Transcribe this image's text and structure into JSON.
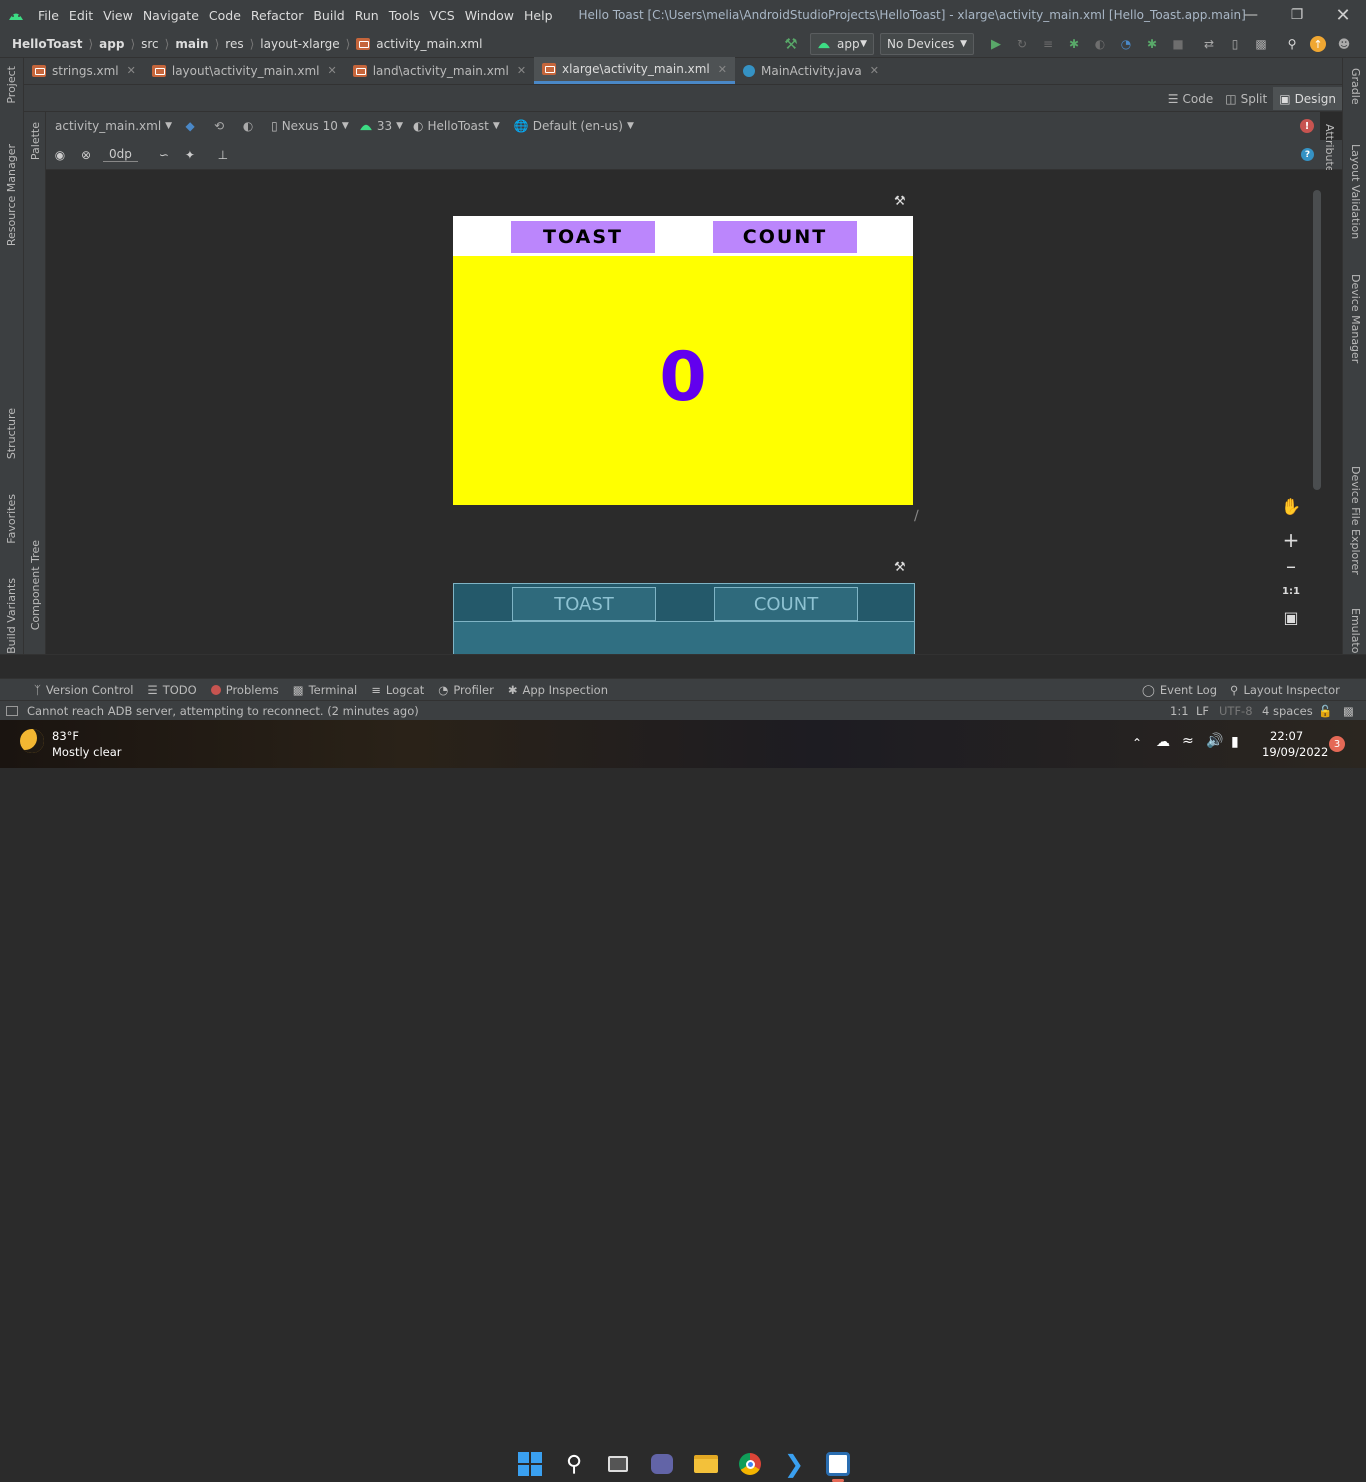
{
  "title_bar": {
    "menu": [
      "File",
      "Edit",
      "View",
      "Navigate",
      "Code",
      "Refactor",
      "Build",
      "Run",
      "Tools",
      "VCS",
      "Window",
      "Help"
    ],
    "title": "Hello Toast [C:\\Users\\melia\\AndroidStudioProjects\\HelloToast] - xlarge\\activity_main.xml [Hello_Toast.app.main]"
  },
  "breadcrumb": {
    "items": [
      "HelloToast",
      "app",
      "src",
      "main",
      "res",
      "layout-xlarge",
      "activity_main.xml"
    ]
  },
  "run_toolbar": {
    "config": "app",
    "device": "No Devices"
  },
  "editor_tabs": [
    {
      "label": "strings.xml",
      "icon": "xml-file-icon"
    },
    {
      "label": "layout\\activity_main.xml",
      "icon": "xml-file-icon"
    },
    {
      "label": "land\\activity_main.xml",
      "icon": "xml-file-icon"
    },
    {
      "label": "xlarge\\activity_main.xml",
      "icon": "xml-file-icon",
      "active": true
    },
    {
      "label": "MainActivity.java",
      "icon": "java-class-icon"
    }
  ],
  "view_modes": {
    "code": "Code",
    "split": "Split",
    "design": "Design"
  },
  "design_toolbar": {
    "file": "activity_main.xml",
    "device": "Nexus 10",
    "api": "33",
    "theme": "HelloToast",
    "locale": "Default (en-us)",
    "margin": "0dp"
  },
  "left_tools": [
    "Project",
    "Resource Manager",
    "Structure",
    "Favorites",
    "Build Variants"
  ],
  "left_tools2": [
    "Palette",
    "Component Tree"
  ],
  "right_tools": [
    "Gradle",
    "Attributes",
    "Layout Validation",
    "Device Manager",
    "Device File Explorer",
    "Emulator"
  ],
  "design_preview": {
    "toast_label": "TOAST",
    "count_label": "COUNT",
    "count_value": "0",
    "colors": {
      "button": "#bb86fc",
      "background": "#ffff00",
      "count": "#6200ee"
    }
  },
  "blueprint_preview": {
    "toast_label": "TOAST",
    "count_label": "COUNT"
  },
  "zoom_controls": {
    "fit": "1:1"
  },
  "bottom_tools": [
    "Version Control",
    "TODO",
    "Problems",
    "Terminal",
    "Logcat",
    "Profiler",
    "App Inspection"
  ],
  "bottom_right_tools": [
    "Event Log",
    "Layout Inspector"
  ],
  "status": {
    "message": "Cannot reach ADB server, attempting to reconnect. (2 minutes ago)",
    "position": "1:1",
    "line_sep": "LF",
    "encoding": "UTF-8",
    "indent": "4 spaces"
  },
  "taskbar": {
    "weather_temp": "83°F",
    "weather_desc": "Mostly clear",
    "time": "22:07",
    "date": "19/09/2022",
    "notifications": "3"
  }
}
